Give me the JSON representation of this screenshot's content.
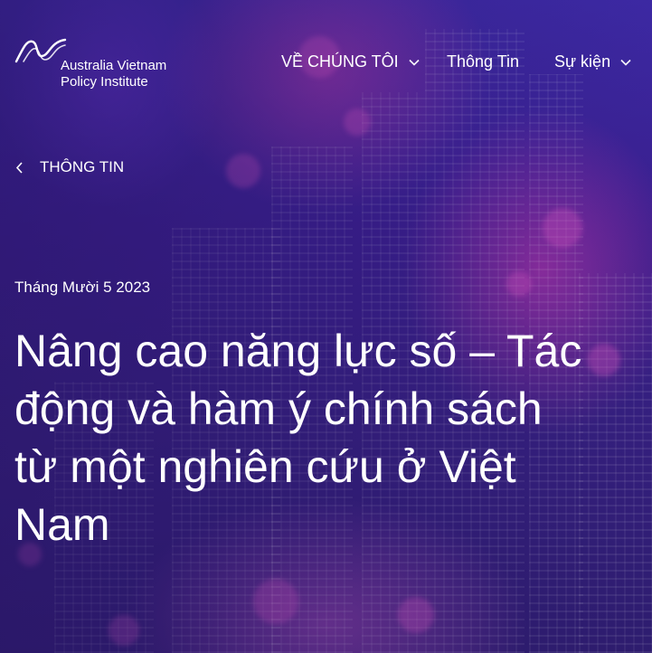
{
  "brand": {
    "line1": "Australia Vietnam",
    "line2": "Policy Institute"
  },
  "nav": {
    "items": [
      {
        "label": "VỀ CHÚNG TÔI",
        "has_dropdown": true
      },
      {
        "label": "Thông Tin",
        "has_dropdown": false
      },
      {
        "label": "Sự kiện",
        "has_dropdown": true
      }
    ]
  },
  "breadcrumb": {
    "back_label": "THÔNG TIN"
  },
  "article": {
    "date": "Tháng Mười 5 2023",
    "title": "Nâng cao năng lực số – Tác động và hàm ý chính sách từ một nghiên cứu ở Việt Nam"
  },
  "colors": {
    "background_primary": "#3a1f8f",
    "accent_pink": "#d23cb4",
    "text": "#ffffff"
  },
  "icons": {
    "logo": "wave-logo-icon",
    "dropdown": "chevron-down-icon",
    "back": "chevron-left-icon"
  }
}
